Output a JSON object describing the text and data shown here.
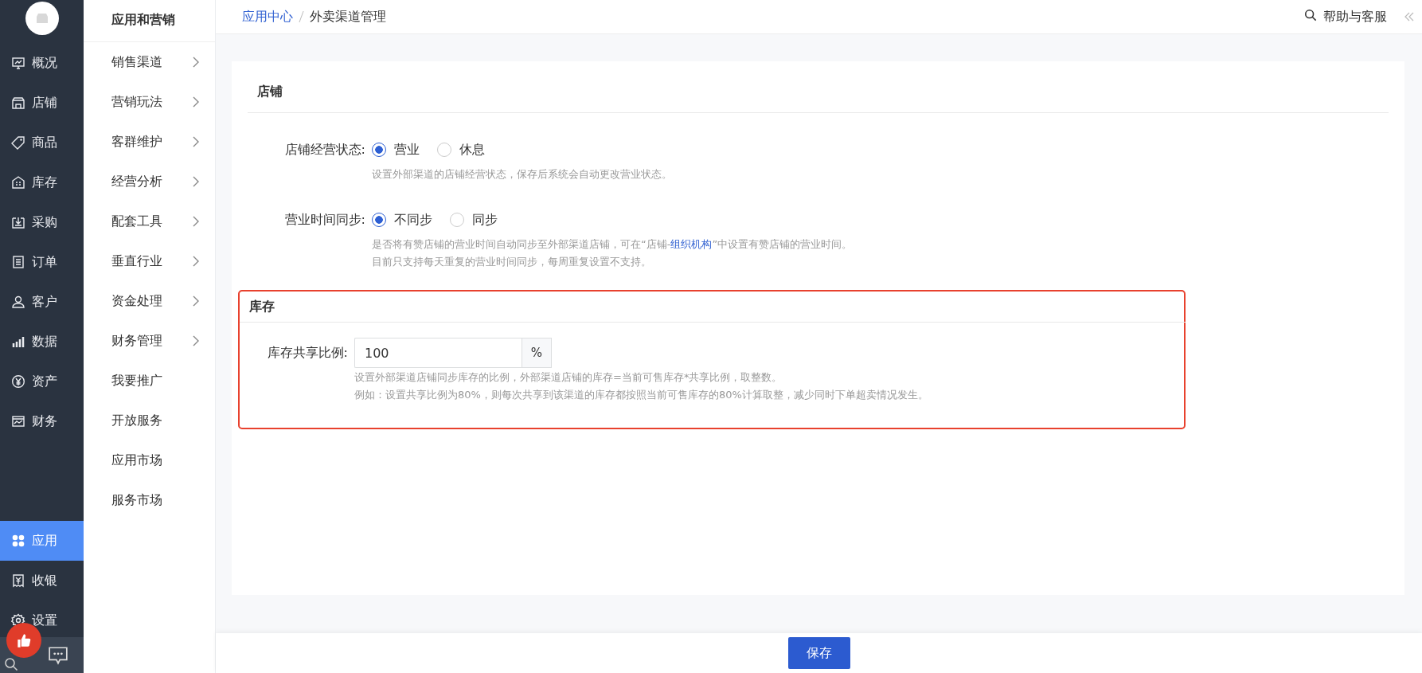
{
  "nav": {
    "items": [
      {
        "label": "概况",
        "selected": false
      },
      {
        "label": "店铺",
        "selected": false
      },
      {
        "label": "商品",
        "selected": false
      },
      {
        "label": "库存",
        "selected": false
      },
      {
        "label": "采购",
        "selected": false
      },
      {
        "label": "订单",
        "selected": false
      },
      {
        "label": "客户",
        "selected": false
      },
      {
        "label": "数据",
        "selected": false
      },
      {
        "label": "资产",
        "selected": false
      },
      {
        "label": "财务",
        "selected": false
      }
    ],
    "bottom_items": [
      {
        "label": "应用",
        "selected": true
      },
      {
        "label": "收银",
        "selected": false
      },
      {
        "label": "设置",
        "selected": false
      }
    ]
  },
  "submenu": {
    "title": "应用和营销",
    "items": [
      {
        "label": "销售渠道",
        "expandable": true
      },
      {
        "label": "营销玩法",
        "expandable": true
      },
      {
        "label": "客群维护",
        "expandable": true
      },
      {
        "label": "经营分析",
        "expandable": true
      },
      {
        "label": "配套工具",
        "expandable": true
      },
      {
        "label": "垂直行业",
        "expandable": true
      },
      {
        "label": "资金处理",
        "expandable": true
      },
      {
        "label": "财务管理",
        "expandable": true
      },
      {
        "label": "我要推广",
        "expandable": false
      },
      {
        "label": "开放服务",
        "expandable": false
      },
      {
        "label": "应用市场",
        "expandable": false
      },
      {
        "label": "服务市场",
        "expandable": false
      }
    ]
  },
  "breadcrumb": [
    {
      "label": "应用中心",
      "link": true
    },
    {
      "label": "外卖渠道管理",
      "link": false
    }
  ],
  "help": "帮助与客服",
  "sections": [
    {
      "title": "店铺",
      "highlighted": false,
      "fields": [
        {
          "kind": "radio",
          "label": "店铺经营状态:",
          "options": [
            {
              "label": "营业",
              "selected": true
            },
            {
              "label": "休息",
              "selected": false
            }
          ],
          "hints": [
            "设置外部渠道的店铺经营状态，保存后系统会自动更改营业状态。"
          ]
        },
        {
          "kind": "radio",
          "label": "营业时间同步:",
          "options": [
            {
              "label": "不同步",
              "selected": true
            },
            {
              "label": "同步",
              "selected": false
            }
          ],
          "hints": [
            {
              "text": "是否将有赞店铺的营业时间自动同步至外部渠道店铺，可在“店铺-",
              "link": "组织机构",
              "after": "”中设置有赞店铺的营业时间。"
            },
            "目前只支持每天重复的营业时间同步，每周重复设置不支持。"
          ]
        }
      ]
    },
    {
      "title": "库存",
      "highlighted": true,
      "fields": [
        {
          "kind": "input",
          "label": "库存共享比例:",
          "value": "100",
          "suffix": "%",
          "hints": [
            "设置外部渠道店铺同步库存的比例，外部渠道店铺的库存=当前可售库存*共享比例，取整数。",
            "例如：设置共享比例为80%，则每次共享到该渠道的库存都按照当前可售库存的80%计算取整，减少同时下单超卖情况发生。"
          ]
        }
      ]
    }
  ],
  "save_button": "保存"
}
